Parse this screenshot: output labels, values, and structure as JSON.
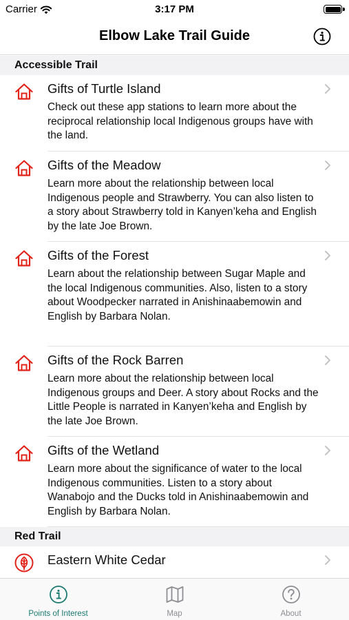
{
  "status_bar": {
    "carrier": "Carrier",
    "time": "3:17 PM"
  },
  "nav": {
    "title": "Elbow Lake Trail Guide",
    "info_icon": "info-circle-icon"
  },
  "colors": {
    "accent_red": "#e2231a",
    "tab_active": "#1b7a72",
    "tab_inactive": "#8e8e93"
  },
  "sections": [
    {
      "title": "Accessible Trail",
      "rows": [
        {
          "title": "Gifts of Turtle Island",
          "icon": "house-icon",
          "description": "Check out these app stations to learn more about the reciprocal relationship local Indigenous groups have with the land."
        },
        {
          "title": "Gifts of the Meadow",
          "icon": "house-icon",
          "description": "Learn more about the relationship between local Indigenous people and Strawberry. You can also listen to a story about Strawberry told in Kanyen’keha and English by the late Joe Brown."
        },
        {
          "title": "Gifts of the Forest",
          "icon": "house-icon",
          "description": "Learn about the relationship between Sugar Maple and the local Indigenous communities. Also, listen to a story about Woodpecker narrated in Anishinaabemowin and English by Barbara Nolan."
        },
        {
          "title": "Gifts of the Rock Barren",
          "icon": "house-icon",
          "description": "Learn more about the relationship between local Indigenous groups and Deer. A story about Rocks and the Little People is narrated in Kanyen’keha and English by the late Joe Brown."
        },
        {
          "title": "Gifts of the Wetland",
          "icon": "house-icon",
          "description": "Learn more about the significance of water to the local Indigenous communities. Listen to a story about Wanabojo and the Ducks told in Anishinaabemowin and English by Barbara Nolan."
        }
      ]
    },
    {
      "title": "Red Trail",
      "rows": [
        {
          "title": "Eastern White Cedar",
          "icon": "leaf-icon",
          "description": ""
        }
      ]
    }
  ],
  "tabs": [
    {
      "label": "Points of Interest",
      "icon": "info-circle-icon",
      "active": true
    },
    {
      "label": "Map",
      "icon": "map-icon",
      "active": false
    },
    {
      "label": "About",
      "icon": "question-circle-icon",
      "active": false
    }
  ]
}
